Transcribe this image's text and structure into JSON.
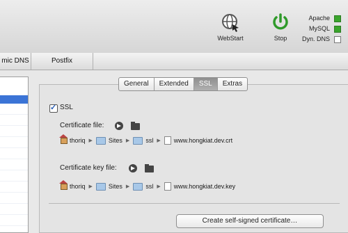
{
  "toolbar": {
    "webstart_label": "WebStart",
    "stop_label": "Stop",
    "status": [
      {
        "label": "Apache",
        "on": true
      },
      {
        "label": "MySQL",
        "on": true
      },
      {
        "label": "Dyn. DNS",
        "on": false
      }
    ]
  },
  "top_tabs": [
    "mic DNS",
    "Postfix"
  ],
  "ssl_tabs": [
    "General",
    "Extended",
    "SSL",
    "Extras"
  ],
  "ssl": {
    "checkbox_label": "SSL",
    "cert_file_label": "Certificate file:",
    "cert_path": [
      "thoriq",
      "Sites",
      "ssl",
      "www.hongkiat.dev.crt"
    ],
    "cert_key_label": "Certificate key file:",
    "key_path": [
      "thoriq",
      "Sites",
      "ssl",
      "www.hongkiat.dev.key"
    ],
    "create_button": "Create self-signed certificate…"
  },
  "colors": {
    "accent": "#3b74d6",
    "status_on": "#3aa52c",
    "stop_power": "#2f9a2a"
  }
}
